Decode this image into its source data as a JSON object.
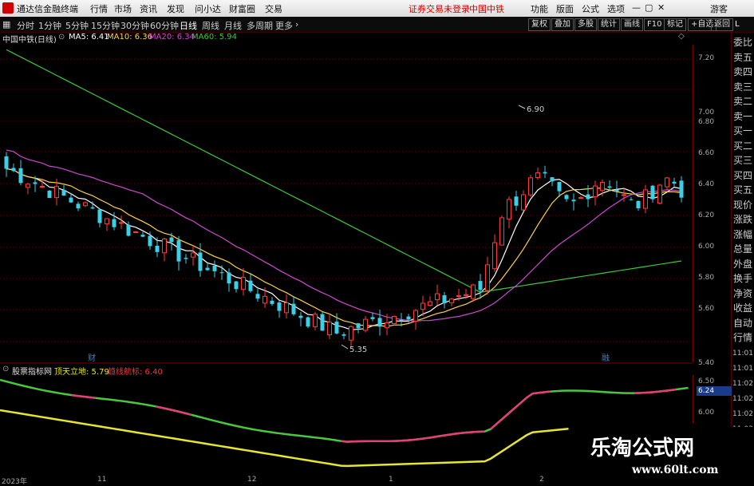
{
  "app": {
    "title": "通达信金融终端",
    "menu": [
      "行情",
      "市场",
      "资讯",
      "发现",
      "问小达",
      "财富圈",
      "交易"
    ],
    "status": "证券交易未登录",
    "stock_tag": "中国中铁",
    "right_menu": [
      "功能",
      "版面",
      "公式",
      "选项"
    ],
    "guest": "游客"
  },
  "periods": [
    "分时",
    "1分钟",
    "5分钟",
    "15分钟",
    "30分钟",
    "60分钟",
    "日线",
    "周线",
    "月线",
    "多周期",
    "更多"
  ],
  "active_period": "日线",
  "tools": [
    "复权",
    "叠加",
    "多股",
    "统计",
    "画线",
    "F10",
    "标记",
    "+自选",
    "返回"
  ],
  "main_chart": {
    "name": "中国中铁(日线)",
    "ma": [
      {
        "label": "MA5: 6.41",
        "color": "#ffffff"
      },
      {
        "label": "MA10: 6.36",
        "color": "#ffd24a"
      },
      {
        "label": "MA20: 6.34",
        "color": "#d04ad0"
      },
      {
        "label": "MA60: 5.94",
        "color": "#3cc83c"
      }
    ],
    "axis_labels": [
      "7.20",
      "7.00",
      "6.80",
      "6.60",
      "6.40",
      "6.20",
      "6.00",
      "5.80",
      "5.60",
      "5.40"
    ],
    "high_label": "6.90",
    "low_label": "5.35",
    "markers": [
      "财",
      "融"
    ]
  },
  "sidebar": [
    "委比",
    "卖五",
    "卖四",
    "卖三",
    "卖二",
    "卖一",
    "买一",
    "买二",
    "买三",
    "买四",
    "买五",
    "现价",
    "涨跌",
    "涨幅",
    "总量",
    "外盘",
    "换手",
    "净资",
    "收益",
    "自动",
    "行情"
  ],
  "sidebar_top": "L",
  "time_col": [
    "11:01",
    "11:01",
    "11:02",
    "11:02",
    "11:02",
    "11:02",
    "11:0"
  ],
  "indicator": {
    "name": "股票指标网",
    "line1": "顶天立地: 5.79",
    "line2": "趋线航标: 6.40",
    "axis_labels": [
      "6.50",
      "6.00"
    ],
    "current": "6.24",
    "line1_color": "#e6e62e",
    "line2_color": "#4ac83c",
    "highlight_color": "#e63c78"
  },
  "date_axis": [
    "2023年",
    "11",
    "12",
    "1",
    "2"
  ],
  "watermark": {
    "title": "乐淘公式网",
    "url": "www.60lt.com"
  },
  "colors": {
    "up": "#ff3c3c",
    "down": "#3ccfe6",
    "grid": "#7a0000"
  }
}
